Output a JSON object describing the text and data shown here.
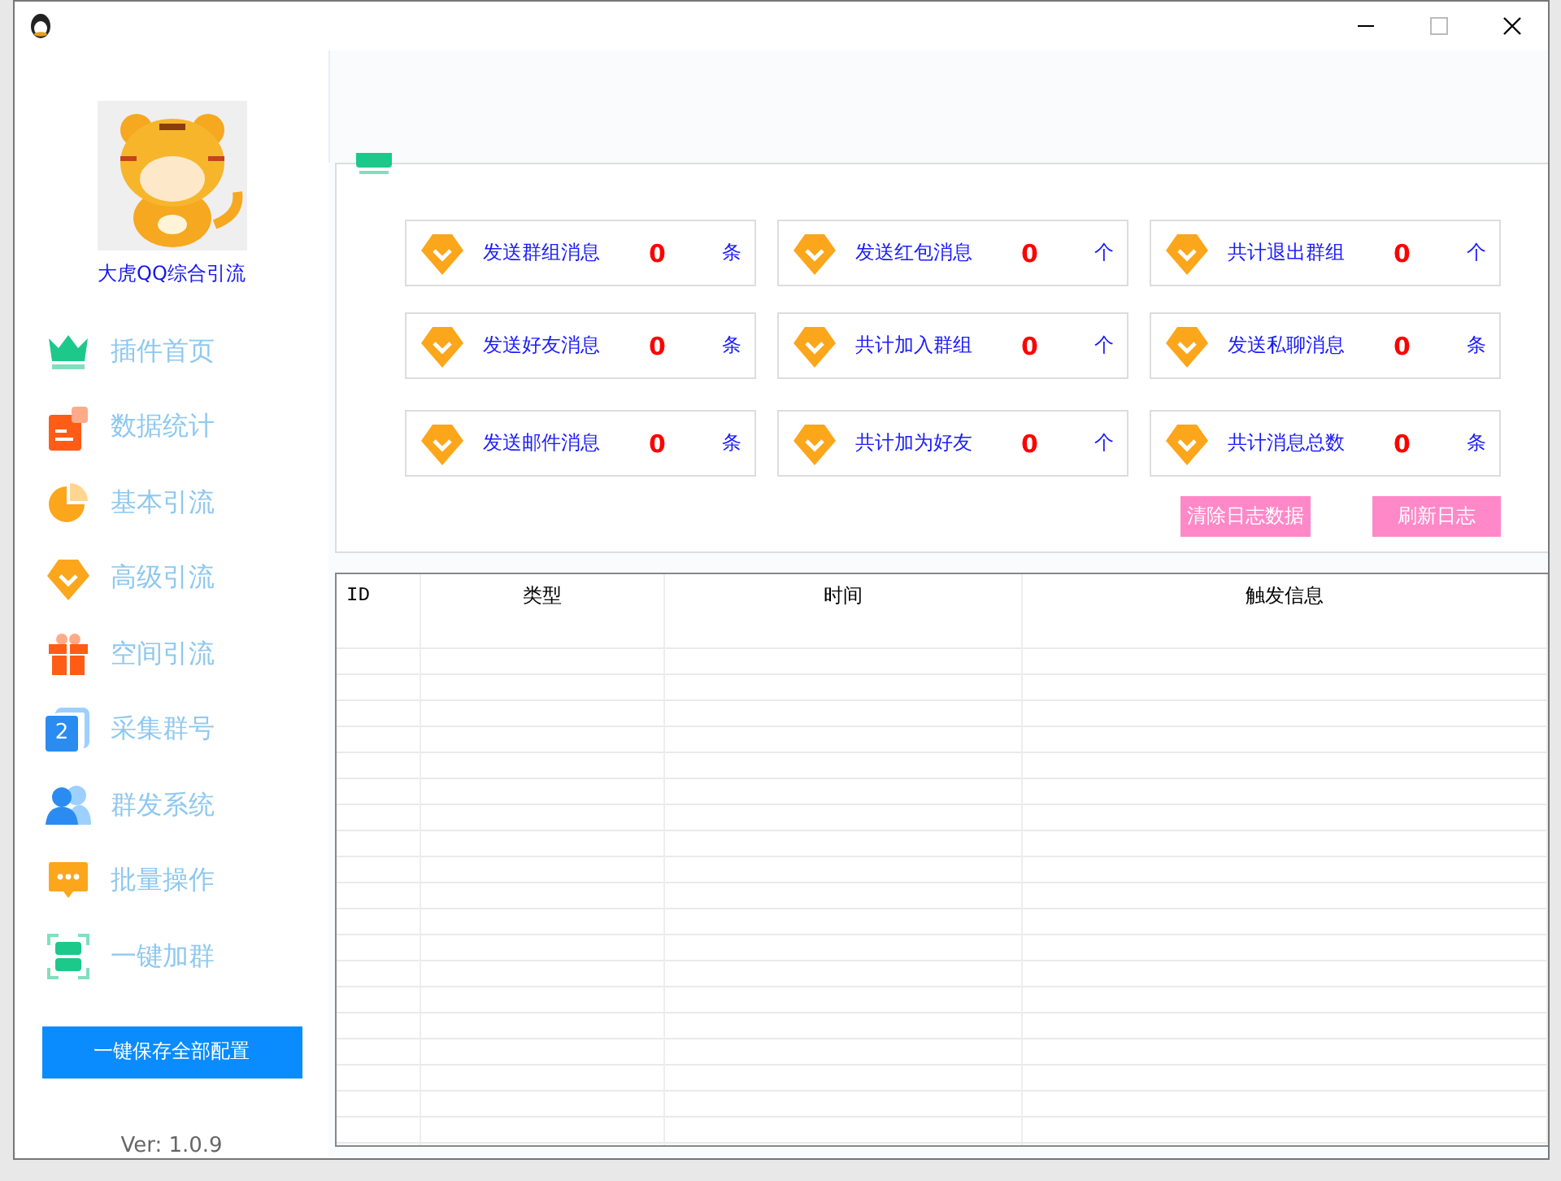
{
  "sidebar": {
    "logo_caption": "大虎QQ综合引流",
    "items": [
      {
        "label": "插件首页"
      },
      {
        "label": "数据统计"
      },
      {
        "label": "基本引流"
      },
      {
        "label": "高级引流"
      },
      {
        "label": "空间引流"
      },
      {
        "label": "采集群号",
        "icon_text": "2"
      },
      {
        "label": "群发系统"
      },
      {
        "label": "批量操作"
      },
      {
        "label": "一键加群"
      }
    ],
    "save_button": "一键保存全部配置",
    "version": "Ver: 1.0.9"
  },
  "stats": [
    {
      "label": "发送群组消息",
      "value": "0",
      "unit": "条"
    },
    {
      "label": "发送红包消息",
      "value": "0",
      "unit": "个"
    },
    {
      "label": "共计退出群组",
      "value": "0",
      "unit": "个"
    },
    {
      "label": "发送好友消息",
      "value": "0",
      "unit": "条"
    },
    {
      "label": "共计加入群组",
      "value": "0",
      "unit": "个"
    },
    {
      "label": "发送私聊消息",
      "value": "0",
      "unit": "条"
    },
    {
      "label": "发送邮件消息",
      "value": "0",
      "unit": "条"
    },
    {
      "label": "共计加为好友",
      "value": "0",
      "unit": "个"
    },
    {
      "label": "共计消息总数",
      "value": "0",
      "unit": "条"
    }
  ],
  "log_buttons": [
    "清除日志数据",
    "刷新日志"
  ],
  "table": {
    "columns": [
      "ID",
      "类型",
      "时间",
      "触发信息"
    ]
  }
}
